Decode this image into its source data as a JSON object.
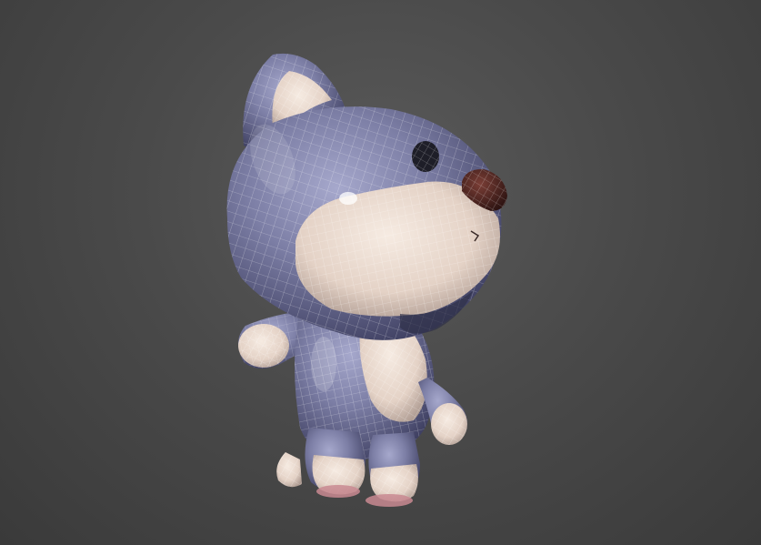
{
  "viewport": {
    "subject": "cartoon-dog-character-wireframe-model",
    "colors": {
      "background_center": "#5a5a5a",
      "background_edge": "#3a3a3a",
      "body_purple": "#7d7fa6",
      "body_purple_dark": "#4a4b6e",
      "belly_cream": "#e8d8cc",
      "belly_cream_shade": "#b8a49a",
      "nose": "#4a2420",
      "eye": "#1e1e28",
      "ear_inner": "#e6d6ca",
      "paw_pad": "#c98a92",
      "wire": "#ffffff"
    }
  }
}
